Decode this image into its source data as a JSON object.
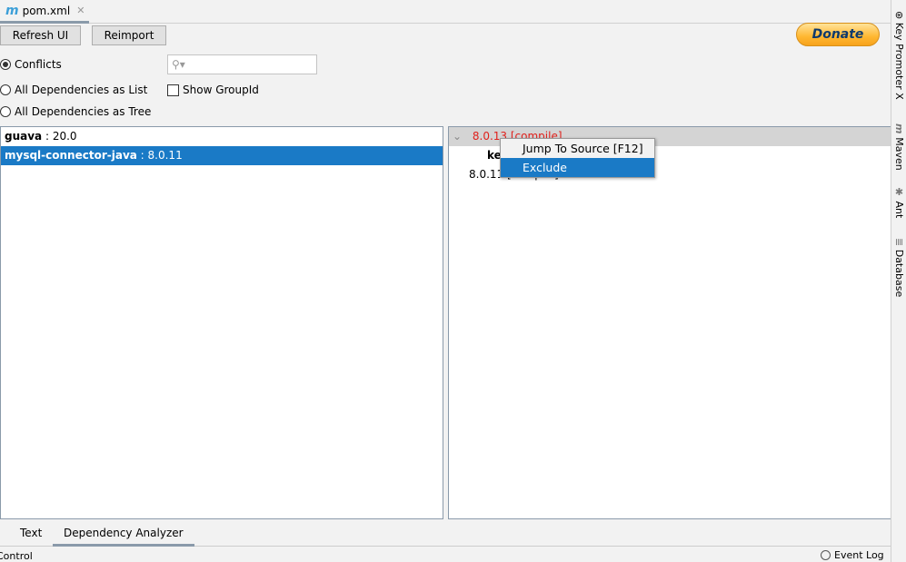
{
  "file_tab": {
    "label": "pom.xml",
    "icon": "maven-icon"
  },
  "toolbar": {
    "refresh": "Refresh UI",
    "reimport": "Reimport",
    "donate": "Donate"
  },
  "options": {
    "conflicts": "Conflicts",
    "list": "All Dependencies as List",
    "tree": "All Dependencies as Tree",
    "show_groupid": "Show GroupId",
    "selected": "Conflicts",
    "show_groupid_checked": false
  },
  "search": {
    "value": "",
    "icon": "search-icon"
  },
  "left_list": [
    {
      "name": "guava",
      "version": " : 20.0",
      "selected": false
    },
    {
      "name": "mysql-connector-java",
      "version": " : 8.0.11",
      "selected": true
    }
  ],
  "right_tree": {
    "header": "8.0.13 [compile]",
    "child": "ke",
    "child2": "8.0.11 [compile]"
  },
  "context_menu": {
    "items": [
      "Jump To Source [F12]",
      "Exclude"
    ],
    "highlighted": "Exclude"
  },
  "side_tools": [
    "Key Promoter X",
    "Maven",
    "Ant",
    "Database"
  ],
  "bottom_tabs": {
    "text": "Text",
    "analyzer": "Dependency Analyzer",
    "active": "Dependency Analyzer"
  },
  "status": {
    "left": "Control",
    "event_log": "Event Log"
  },
  "colors": {
    "selection": "#1a7ac6",
    "conflict": "#e0201b"
  }
}
